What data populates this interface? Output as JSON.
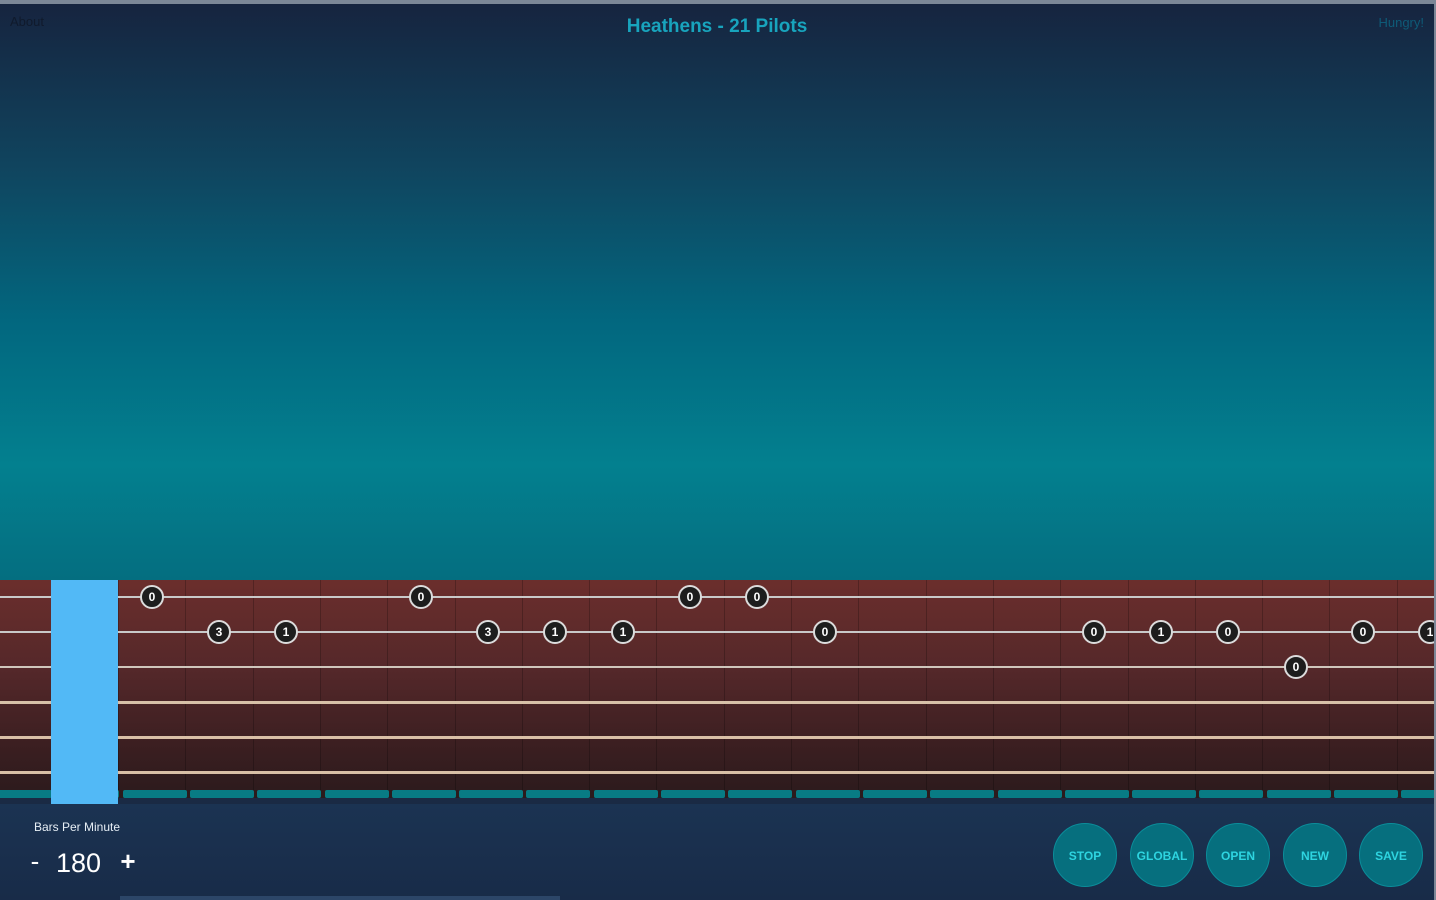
{
  "header": {
    "about_label": "About",
    "song_title": "Heathens - 21 Pilots",
    "hungry_label": "Hungry!"
  },
  "tab": {
    "notes": [
      {
        "string": 1,
        "step": 2,
        "fret": "0"
      },
      {
        "string": 2,
        "step": 3,
        "fret": "3"
      },
      {
        "string": 2,
        "step": 4,
        "fret": "1"
      },
      {
        "string": 1,
        "step": 6,
        "fret": "0"
      },
      {
        "string": 2,
        "step": 7,
        "fret": "3"
      },
      {
        "string": 2,
        "step": 8,
        "fret": "1"
      },
      {
        "string": 2,
        "step": 9,
        "fret": "1"
      },
      {
        "string": 1,
        "step": 10,
        "fret": "0"
      },
      {
        "string": 1,
        "step": 11,
        "fret": "0"
      },
      {
        "string": 2,
        "step": 12,
        "fret": "0"
      },
      {
        "string": 2,
        "step": 16,
        "fret": "0"
      },
      {
        "string": 2,
        "step": 17,
        "fret": "1"
      },
      {
        "string": 2,
        "step": 18,
        "fret": "0"
      },
      {
        "string": 3,
        "step": 19,
        "fret": "0"
      },
      {
        "string": 2,
        "step": 20,
        "fret": "0"
      },
      {
        "string": 2,
        "step": 21,
        "fret": "1"
      }
    ],
    "playhead_step": 1
  },
  "controls": {
    "bpm_label": "Bars Per Minute",
    "bpm_minus": "-",
    "bpm_value": "180",
    "bpm_plus": "+",
    "buttons": {
      "stop": "STOP",
      "global": "GLOBAL",
      "open": "OPEN",
      "new": "NEW",
      "save": "SAVE"
    }
  },
  "colors": {
    "title": "#18a4bd",
    "playhead": "#52b9f6",
    "button_fill": "#066f7e",
    "button_text": "#2ed4e0"
  }
}
